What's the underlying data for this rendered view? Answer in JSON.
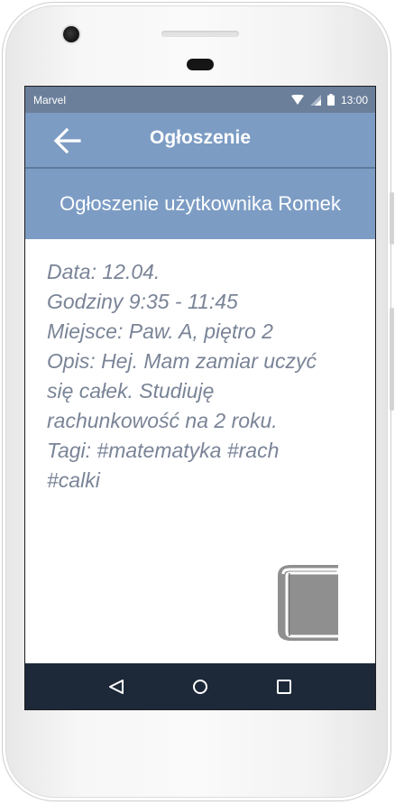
{
  "statusbar": {
    "carrier": "Marvel",
    "time": "13:00",
    "icons": [
      "wifi-icon",
      "signal-icon",
      "battery-icon"
    ]
  },
  "appbar": {
    "title": "Ogłoszenie",
    "back_icon": "arrow-left-icon"
  },
  "subheader": {
    "title": "Ogłoszenie użytkownika Romek"
  },
  "details": {
    "lines": [
      "Data: 12.04.",
      "Godziny 9:35 - 11:45",
      "Miejsce: Paw. A, piętro 2",
      "Opis: Hej. Mam zamiar uczyć",
      "się całek. Studiuję",
      "rachunkowość na 2 roku.",
      "Tagi: #matematyka #rach",
      "#calki"
    ]
  },
  "decor": {
    "icon": "book-icon"
  },
  "navbar": {
    "buttons": [
      "back-triangle-icon",
      "home-circle-icon",
      "recents-square-icon"
    ]
  },
  "colors": {
    "statusbar": "#6b7f9b",
    "primary": "#7c9cc4",
    "text": "#7a8497",
    "navbar": "#1d2939",
    "book": "#8f8f8f"
  }
}
